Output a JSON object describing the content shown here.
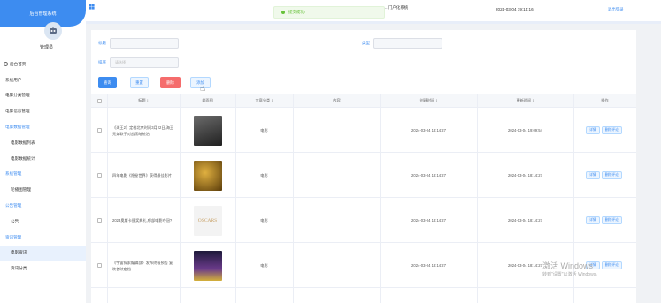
{
  "app": {
    "brand": "后台管理系统",
    "user_name": "管理员",
    "system_title": "...门户化系统",
    "datetime": "2024-03-04 19:14:16",
    "logout": "退出登录"
  },
  "toast": {
    "message": "提交成功!"
  },
  "sidebar": {
    "items": [
      {
        "label": "后台首页",
        "type": "top"
      },
      {
        "label": "系统用户",
        "type": "item"
      },
      {
        "label": "电影分类管理",
        "type": "item"
      },
      {
        "label": "电影信息管理",
        "type": "item"
      },
      {
        "label": "电影数据管理",
        "type": "group"
      },
      {
        "label": "电影数据列表",
        "type": "sub"
      },
      {
        "label": "电影数据统计",
        "type": "sub"
      },
      {
        "label": "系统管理",
        "type": "group"
      },
      {
        "label": "轮播图管理",
        "type": "sub"
      },
      {
        "label": "公告管理",
        "type": "group"
      },
      {
        "label": "公告",
        "type": "sub"
      },
      {
        "label": "资讯管理",
        "type": "group"
      },
      {
        "label": "电影资讯",
        "type": "sub-active"
      },
      {
        "label": "资讯分类",
        "type": "sub"
      }
    ]
  },
  "search": {
    "title_label": "标题",
    "sort_label": "排序",
    "sort_placeholder": "请选择",
    "type_label": "类型"
  },
  "buttons": {
    "query": "查询",
    "reset": "重置",
    "delete": "删除",
    "add": "添加"
  },
  "table": {
    "headers": [
      "标题 ↕",
      "封面图",
      "文章分类 ↕",
      "内容",
      "创建时间 ↕",
      "更新时间 ↕",
      "操作"
    ],
    "rows": [
      {
        "title": "《海王2》定档北京时间3月22日,海王兄弟联手对战黑暗统治",
        "category": "电影",
        "created": "2024-03-04 18:14:27",
        "updated": "2024-03-04 19:09:54",
        "thumb": "#3a3a3a"
      },
      {
        "title": "四年电影《隐秘世界》获得最佳影片",
        "category": "电影",
        "created": "2024-03-04 18:14:27",
        "updated": "2024-03-04 18:14:27",
        "thumb": "#b8860b"
      },
      {
        "title": "2023奥斯卡颁奖典礼,哪部电影夺冠?",
        "category": "电影",
        "created": "2024-03-04 18:14:27",
        "updated": "2024-03-04 18:14:27",
        "thumb": "#f3f3f3",
        "thumb_text": "OSCARS"
      },
      {
        "title": "《宇宙探索编辑部》发布终极预告 复映首映定档",
        "category": "电影",
        "created": "2024-03-04 18:14:27",
        "updated": "2024-03-04 18:14:27",
        "thumb": "#2a2540"
      }
    ],
    "op_detail": "详情",
    "op_edit": "删除评论"
  },
  "watermark": {
    "line1": "激活 Windows",
    "line2": "转到\"设置\"以激活 Windows。"
  }
}
